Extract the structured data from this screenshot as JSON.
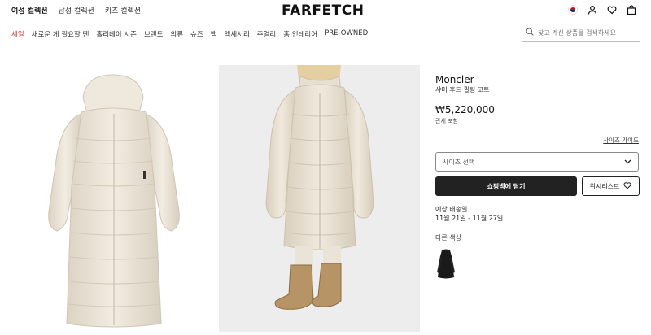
{
  "header": {
    "gender_tabs": [
      "여성 컬렉션",
      "남성 컬렉션",
      "키즈 컬렉션"
    ],
    "logo": "FARFETCH",
    "icons": [
      "flag-icon",
      "user-icon",
      "heart-icon",
      "bag-icon"
    ]
  },
  "nav": {
    "categories": [
      "세일",
      "새로운 게 필요할 땐",
      "홀리데이 시즌",
      "브랜드",
      "의류",
      "슈즈",
      "백",
      "액세서리",
      "주얼리",
      "홈 인테리어",
      "PRE-OWNED"
    ]
  },
  "search": {
    "placeholder": "찾고 계신 상품을 검색하세요"
  },
  "product": {
    "brand": "Moncler",
    "name": "샤머 후드 퀼팅 코트",
    "price": "₩5,220,000",
    "tax_note": "관세 포함",
    "size_guide": "사이즈 가이드",
    "size_select_placeholder": "사이즈 선택",
    "add_to_bag": "쇼핑백에 담기",
    "wishlist": "위시리스트",
    "shipping_label": "예상 배송일",
    "shipping_dates": "11월 21일 - 11월 27일",
    "other_colors_label": "다른 색상"
  },
  "colors": {
    "sale": "#d0302a",
    "coat": "#ece4d6",
    "dark_button": "#222222"
  }
}
